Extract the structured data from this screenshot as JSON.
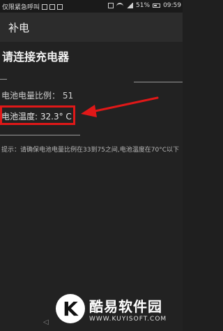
{
  "status_bar": {
    "carrier": "仅限紧急呼叫",
    "battery_percent": "51%",
    "time": "09:59"
  },
  "app_bar": {
    "title": "补电"
  },
  "main": {
    "heading": "请连接充电器",
    "battery_level_label": "电池电量比例：",
    "battery_level_value": "51",
    "battery_temp_text": "电池温度: 32.3° C",
    "tip_text": "提示：请确保电池电量比例在33到75之间,电池温度在70°C以下"
  },
  "annotation": {
    "highlight_color": "#e01818"
  },
  "watermark": {
    "logo_letter": "K",
    "title": "酷易软件园",
    "url": "WWW.KUYISOFT.COM"
  },
  "icons": [
    "wifi-icon",
    "signal-icon",
    "battery-icon",
    "arrow-icon"
  ]
}
